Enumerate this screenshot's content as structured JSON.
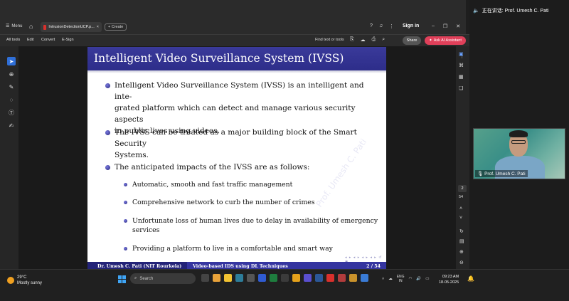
{
  "app": {
    "menu_label": "Menu",
    "tab_title": "IntrusionDetectionUCP.p...",
    "create_label": "+ Create",
    "signin_label": "Sign in"
  },
  "toolbar": {
    "items": [
      "All tools",
      "Edit",
      "Convert",
      "E-Sign"
    ],
    "find_text": "Find text or tools",
    "share_label": "Share",
    "ask_ai_label": "Ask AI Assistant"
  },
  "slide": {
    "title": "Intelligent Video Surveillance System (IVSS)",
    "bullets": [
      {
        "lines": [
          "Intelligent Video Surveillance System (IVSS) is an intelligent and inte-",
          "grated platform which can detect and manage various security aspects",
          "in public lives using videos."
        ]
      },
      {
        "lines": [
          "The IVSS can be treated as a major building block of the Smart Security",
          "Systems."
        ]
      },
      {
        "lines": [
          "The anticipated impacts of the IVSS are as follows:"
        ]
      }
    ],
    "sub_bullets": [
      {
        "lines": [
          "Automatic, smooth and fast traffic management"
        ]
      },
      {
        "lines": [
          "Comprehensive network to curb the number of crimes"
        ]
      },
      {
        "lines": [
          "Unfortunate loss of human lives due to delay in availability of emergency",
          "services"
        ]
      },
      {
        "lines": [
          "Providing a platform to live in a comfortable and smart way"
        ]
      }
    ],
    "footer_author": "Dr. Umesh C. Pati (NIT Rourkela)",
    "footer_title": "Video-based IDS using DL Techniques",
    "footer_page": "2 / 54",
    "watermark": "Prof. Umesh C. Pati"
  },
  "pager": {
    "current": "2",
    "total": "54"
  },
  "meeting": {
    "speaking_label": "正在讲话: Prof. Umesh C. Pati",
    "participant_name": "Prof. Umesh C. Pati"
  },
  "taskbar": {
    "temperature": "29°C",
    "weather": "Mostly sunny",
    "search_placeholder": "Search",
    "lang_top": "ENG",
    "lang_bottom": "IN",
    "time": "09:23 AM",
    "date": "18-05-2025"
  },
  "colors": {
    "slide_title_bar": "#2d2d8a",
    "footer_dark": "#232378",
    "footer_light": "#3535a0",
    "ask_ai": "#e0405a",
    "active_tool": "#2f6fd8"
  }
}
